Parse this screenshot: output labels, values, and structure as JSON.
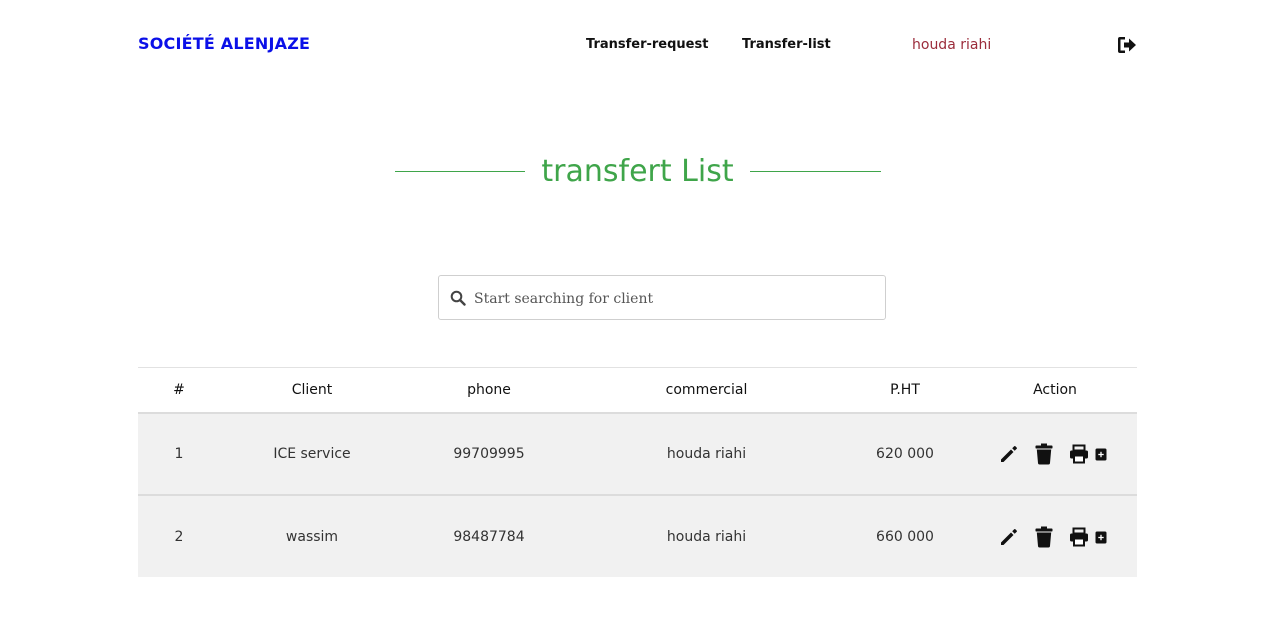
{
  "navbar": {
    "brand": "SOCIÉTÉ ALENJAZE",
    "links": [
      "Transfer-request",
      "Transfer-list"
    ],
    "user": "houda riahi",
    "logout_icon": "sign-out-icon"
  },
  "page": {
    "title": "transfert List"
  },
  "search": {
    "placeholder": "Start searching for client",
    "value": ""
  },
  "table": {
    "columns": [
      "#",
      "Client",
      "phone",
      "commercial",
      "P.HT",
      "Action"
    ],
    "rows": [
      {
        "num": "1",
        "client": "ICE service",
        "phone": "99709995",
        "commercial": "houda riahi",
        "pht": "620 000"
      },
      {
        "num": "2",
        "client": "wassim",
        "phone": "98487784",
        "commercial": "houda riahi",
        "pht": "660 000"
      }
    ],
    "action_icons": [
      "pencil-icon",
      "trash-icon",
      "printer-icon",
      "plus-square-icon"
    ]
  },
  "colors": {
    "brand": "#0b10e8",
    "title": "#3fa54a",
    "user": "#9b2c3b",
    "row_bg": "#f1f1f1"
  }
}
